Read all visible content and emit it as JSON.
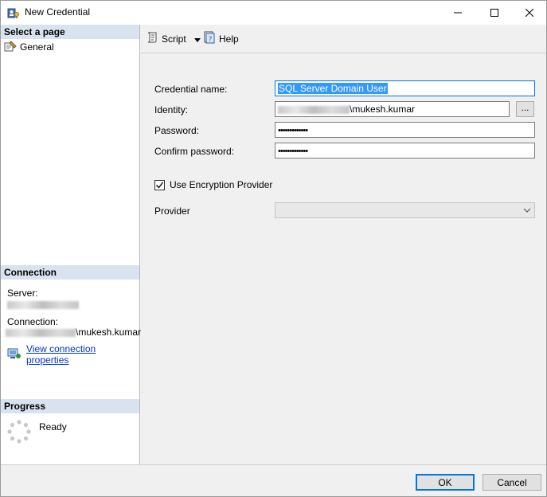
{
  "window": {
    "title": "New Credential",
    "title_icon": "credential-icon"
  },
  "left_pane": {
    "select_page_header": "Select a page",
    "pages": [
      {
        "label": "General",
        "icon": "page-wrench-icon"
      }
    ],
    "connection_header": "Connection",
    "server_label": "Server:",
    "connection_label": "Connection:",
    "connection_user_suffix": "\\mukesh.kumar",
    "view_connection_link": "View connection properties",
    "progress_header": "Progress",
    "progress_status": "Ready"
  },
  "toolbar": {
    "script_label": "Script",
    "help_label": "Help"
  },
  "form": {
    "credential_name_label": "Credential name:",
    "credential_name_value": "SQL Server Domain User",
    "identity_label": "Identity:",
    "identity_suffix": "\\mukesh.kumar",
    "browse_label": "...",
    "password_label": "Password:",
    "password_value": "•••••••••••••",
    "confirm_password_label": "Confirm password:",
    "confirm_password_value": "•••••••••••••",
    "use_encryption_label": "Use Encryption Provider",
    "use_encryption_checked": true,
    "provider_label": "Provider",
    "provider_value": ""
  },
  "buttons": {
    "ok": "OK",
    "cancel": "Cancel"
  },
  "colors": {
    "section_header_bg": "#d8e3ef",
    "accent": "#0078d7",
    "link": "#0033cc",
    "selection": "#3399ff"
  }
}
